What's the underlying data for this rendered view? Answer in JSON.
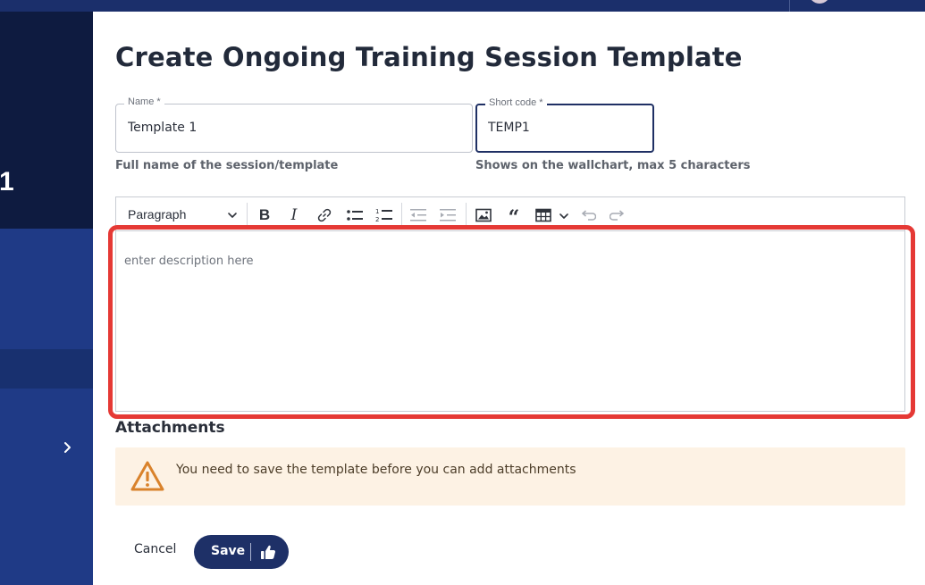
{
  "sidebar": {
    "number": "1"
  },
  "page": {
    "title": "Create Ongoing Training Session Template"
  },
  "form": {
    "name": {
      "label": "Name *",
      "value": "Template 1",
      "helper": "Full name of the session/template"
    },
    "short_code": {
      "label": "Short code *",
      "value": "TEMP1",
      "helper": "Shows on the wallchart, max 5 characters"
    }
  },
  "editor": {
    "paragraph_select": "Paragraph",
    "placeholder": "enter description here",
    "toolbar_icons": [
      "bold-icon",
      "italic-icon",
      "link-icon",
      "bulleted-list-icon",
      "numbered-list-icon",
      "outdent-icon",
      "indent-icon",
      "image-icon",
      "blockquote-icon",
      "table-icon",
      "undo-icon",
      "redo-icon"
    ]
  },
  "attachments": {
    "title": "Attachments",
    "warning": "You need to save the template before you can add attachments"
  },
  "actions": {
    "cancel": "Cancel",
    "save": "Save"
  },
  "colors": {
    "navy": "#1e3067",
    "sidebar": "#1f3a86",
    "sidebar_dark": "#0e1b40",
    "highlight": "#e53935",
    "warning_bg": "#fdf2e4",
    "warning_icon": "#d9822b"
  }
}
